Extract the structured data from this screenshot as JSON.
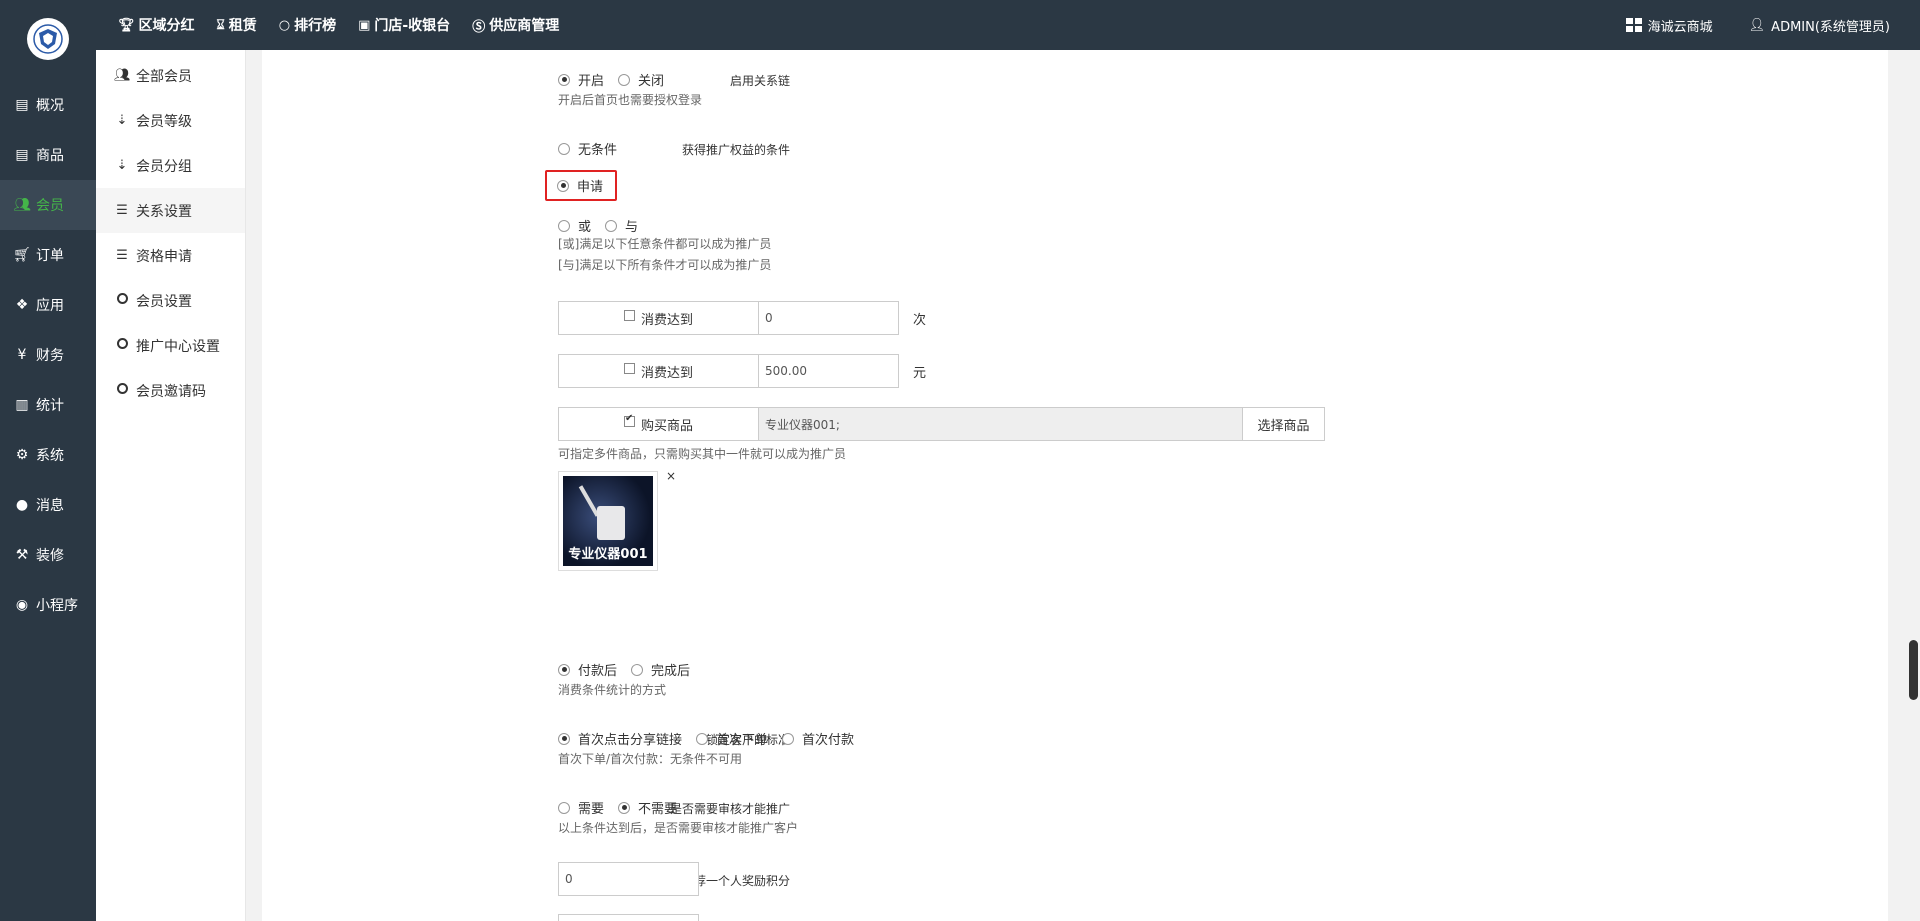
{
  "topnav": {
    "items": [
      {
        "label": "区域分红",
        "icon": "trophy-icon"
      },
      {
        "label": "租赁",
        "icon": "hourglass-icon"
      },
      {
        "label": "排行榜",
        "icon": "circle-icon"
      },
      {
        "label": "门店-收银台",
        "icon": "store-icon"
      },
      {
        "label": "供应商管理",
        "icon": "skype-icon"
      }
    ],
    "store_label": "海诚云商城",
    "user_label": "ADMIN(系统管理员)"
  },
  "sidebar": {
    "items": [
      {
        "label": "概况",
        "icon": "overview-icon"
      },
      {
        "label": "商品",
        "icon": "goods-icon"
      },
      {
        "label": "会员",
        "icon": "users-icon"
      },
      {
        "label": "订单",
        "icon": "cart-icon"
      },
      {
        "label": "应用",
        "icon": "apps-icon"
      },
      {
        "label": "财务",
        "icon": "yen-icon"
      },
      {
        "label": "统计",
        "icon": "bar-chart-icon"
      },
      {
        "label": "系统",
        "icon": "cogs-icon"
      },
      {
        "label": "消息",
        "icon": "comment-icon"
      },
      {
        "label": "装修",
        "icon": "gavel-icon"
      },
      {
        "label": "小程序",
        "icon": "wechat-icon"
      }
    ],
    "active": "会员"
  },
  "submenu": {
    "items": [
      {
        "label": "全部会员",
        "icon": "users-icon"
      },
      {
        "label": "会员等级",
        "icon": "sort-numeric-icon"
      },
      {
        "label": "会员分组",
        "icon": "sort-alpha-icon"
      },
      {
        "label": "关系设置",
        "icon": "sliders-icon"
      },
      {
        "label": "资格申请",
        "icon": "sliders-icon"
      },
      {
        "label": "会员设置",
        "icon": "circle-icon"
      },
      {
        "label": "推广中心设置",
        "icon": "circle-icon"
      },
      {
        "label": "会员邀请码",
        "icon": "circle-icon"
      }
    ],
    "active": "关系设置"
  },
  "form": {
    "relation_chain": {
      "label": "启用关系链",
      "options": [
        "开启",
        "关闭"
      ],
      "selected": "开启",
      "help": "开启后首页也需要授权登录"
    },
    "promo_condition": {
      "label": "获得推广权益的条件",
      "option_none": "无条件",
      "option_apply": "申请",
      "selected": "申请",
      "logic_options": [
        "或",
        "与"
      ],
      "help_or": "[或]满足以下任意条件都可以成为推广员",
      "help_and": "[与]满足以下所有条件才可以成为推广员"
    },
    "conditions": [
      {
        "label": "消费达到",
        "checked": false,
        "value": "0",
        "unit": "次"
      },
      {
        "label": "消费达到",
        "checked": false,
        "value": "500.00",
        "unit": "元"
      }
    ],
    "buy_goods": {
      "label": "购买商品",
      "checked": true,
      "value": "专业仪器001;",
      "button": "选择商品",
      "help": "可指定多件商品，只需购买其中一件就可以成为推广员",
      "product_caption": "专业仪器001",
      "remove_glyph": "×"
    },
    "stat_method": {
      "options": [
        "付款后",
        "完成后"
      ],
      "selected": "付款后",
      "help": "消费条件统计的方式"
    },
    "lock_customer": {
      "label": "锁定客户的标准",
      "options": [
        "首次点击分享链接",
        "首次下单",
        "首次付款"
      ],
      "selected": "首次点击分享链接",
      "help": "首次下单/首次付款：无条件不可用"
    },
    "need_review": {
      "label": "是否需要审核才能推广",
      "options": [
        "需要",
        "不需要"
      ],
      "selected": "不需要",
      "help": "以上条件达到后，是否需要审核才能推广客户"
    },
    "reward_points": {
      "label": "推荐一个人奖励积分",
      "value": "0"
    }
  },
  "colors": {
    "dark_nav": "#2b3844",
    "active_green": "#44b549",
    "highlight_red": "#e02222"
  }
}
